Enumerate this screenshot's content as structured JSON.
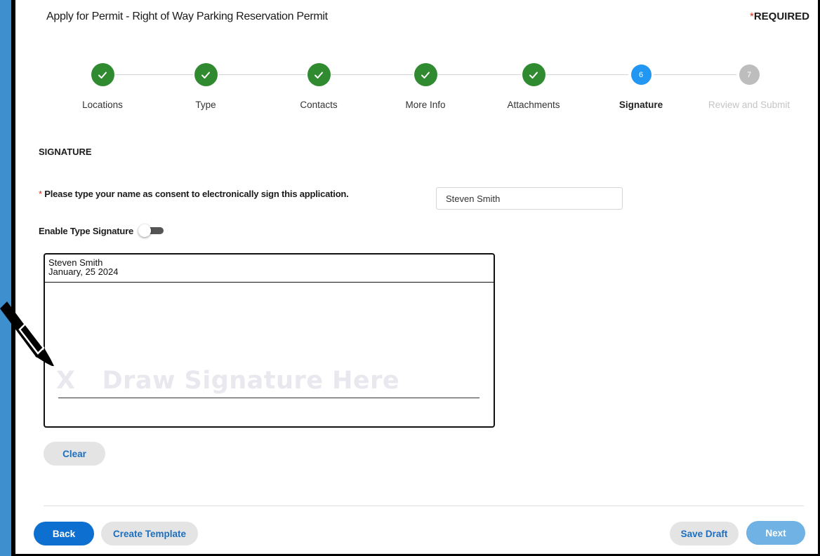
{
  "header": {
    "title": "Apply for Permit - Right of Way Parking Reservation Permit",
    "required_star": "*",
    "required_text": "REQUIRED"
  },
  "stepper": {
    "steps": [
      {
        "label": "Locations",
        "state": "done",
        "number": ""
      },
      {
        "label": "Type",
        "state": "done",
        "number": ""
      },
      {
        "label": "Contacts",
        "state": "done",
        "number": ""
      },
      {
        "label": "More Info",
        "state": "done",
        "number": ""
      },
      {
        "label": "Attachments",
        "state": "done",
        "number": ""
      },
      {
        "label": "Signature",
        "state": "current",
        "number": "6"
      },
      {
        "label": "Review and Submit",
        "state": "todo",
        "number": "7"
      }
    ]
  },
  "signature": {
    "section_title": "SIGNATURE",
    "consent_star": "*",
    "consent_label": " Please type your name as consent to electronically sign this application.",
    "name_value": "Steven Smith",
    "toggle_label": "Enable Type Signature",
    "toggle_on": false,
    "signer_name": "Steven Smith",
    "signed_date": "January, 25 2024",
    "placeholder": "X   Draw Signature Here",
    "clear_label": "Clear"
  },
  "footer": {
    "back_label": "Back",
    "template_label": "Create Template",
    "draft_label": "Save Draft",
    "next_label": "Next"
  },
  "colors": {
    "done": "#2f8a30",
    "current": "#2196f3",
    "todo": "#bdbdbd",
    "primary": "#0d6fcf",
    "required": "#d9301c",
    "outer_background": "#3d8fce"
  }
}
